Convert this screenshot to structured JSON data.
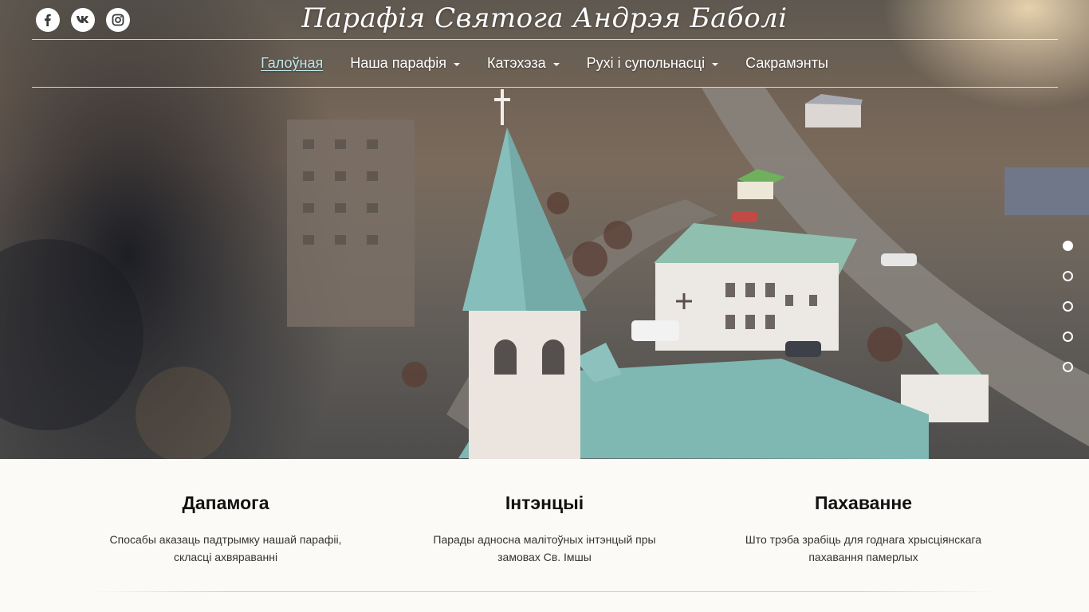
{
  "site": {
    "title": "Парафія Святога Андрэя Баболі"
  },
  "social": [
    {
      "icon": "facebook-icon",
      "label": "f"
    },
    {
      "icon": "vk-icon",
      "label": "vk"
    },
    {
      "icon": "instagram-icon",
      "label": ""
    }
  ],
  "nav": {
    "items": [
      {
        "label": "Галоўная",
        "active": true,
        "dropdown": false
      },
      {
        "label": "Наша парафія",
        "active": false,
        "dropdown": true
      },
      {
        "label": "Катэхэза",
        "active": false,
        "dropdown": true
      },
      {
        "label": "Рухі і супольнасці",
        "active": false,
        "dropdown": true
      },
      {
        "label": "Сакрамэнты",
        "active": false,
        "dropdown": false
      }
    ]
  },
  "slider": {
    "count": 5,
    "active_index": 0
  },
  "features": [
    {
      "title": "Дапамога",
      "text_line1": "Спосабы аказаць падтрымку нашай парафіі,",
      "text_line2": "скласці ахвяраванні"
    },
    {
      "title": "Інтэнцыі",
      "text_line1": "Парады адносна малітоўных інтэнцый пры",
      "text_line2": "замовах Св. Імшы"
    },
    {
      "title": "Пахаванне",
      "text_line1": "Што трэба зрабіць для годнага хрысціянскага",
      "text_line2": "пахавання памерлых"
    }
  ],
  "colors": {
    "active_nav": "#bfe6ea",
    "roof": "#7fb7b3",
    "church_wall": "#e9e2dc"
  }
}
